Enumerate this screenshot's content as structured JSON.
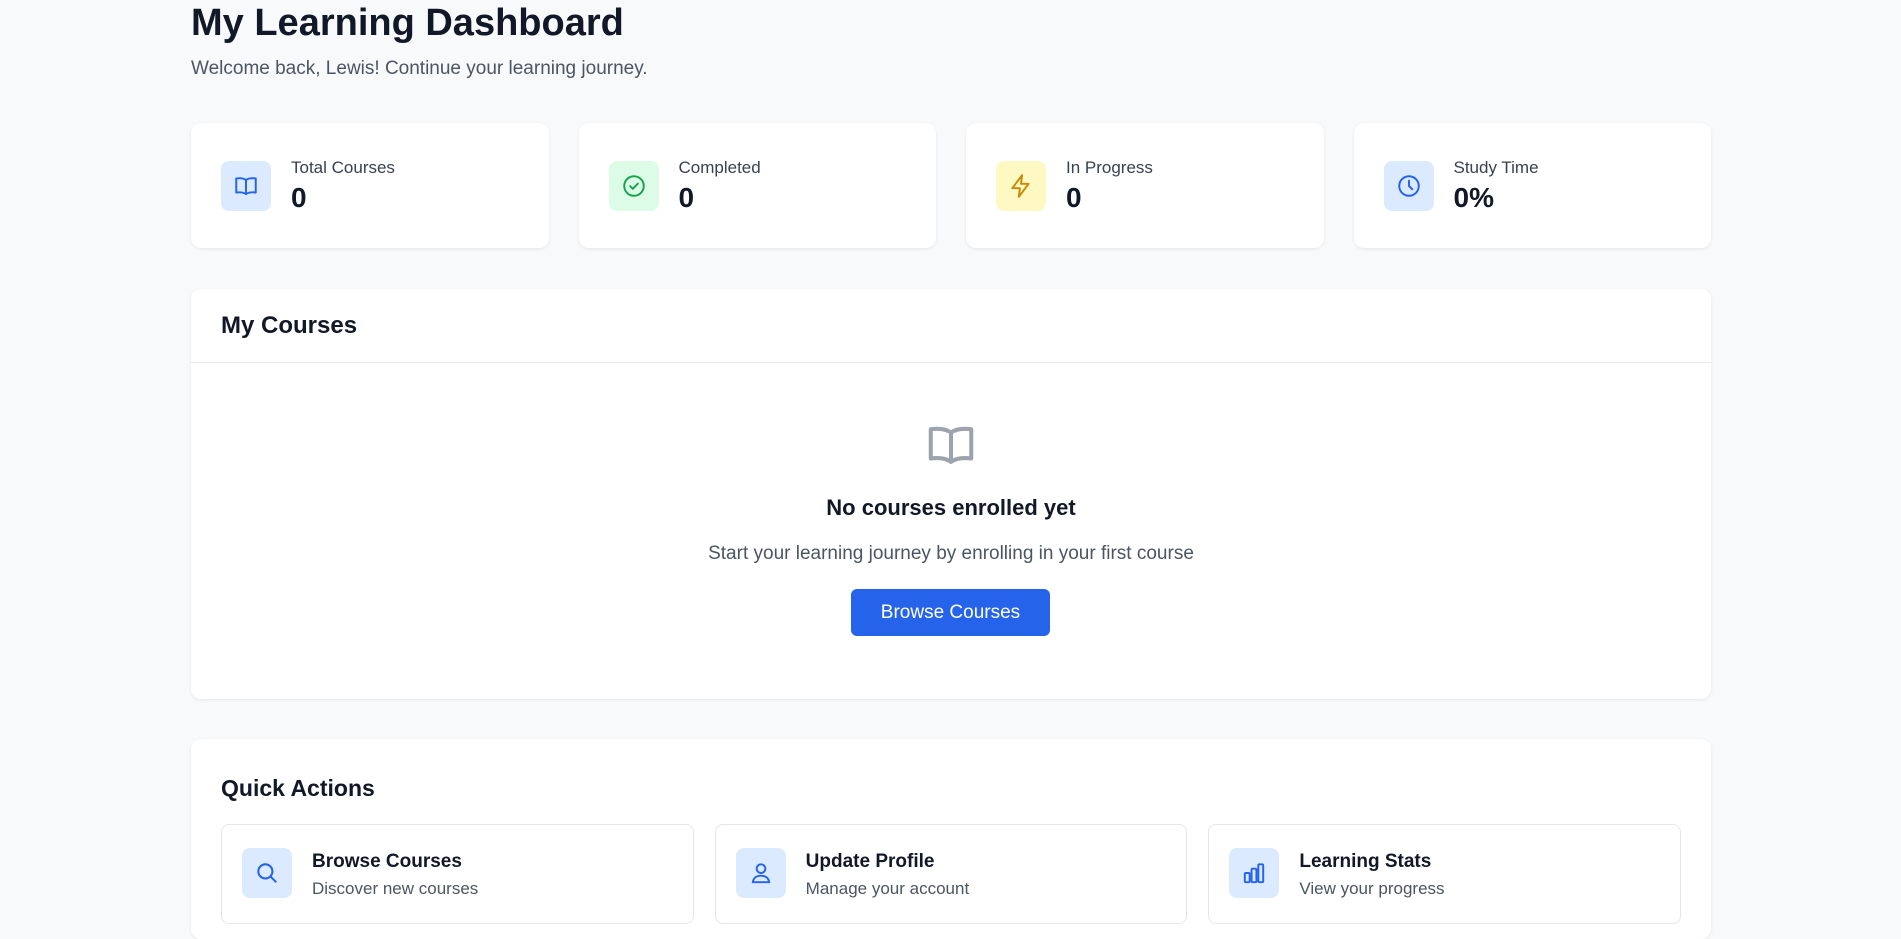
{
  "header": {
    "title": "My Learning Dashboard",
    "subtitle": "Welcome back, Lewis! Continue your learning journey."
  },
  "stats": [
    {
      "label": "Total Courses",
      "value": "0",
      "icon": "book-icon",
      "bg": "#dbeafe",
      "color": "#2563eb"
    },
    {
      "label": "Completed",
      "value": "0",
      "icon": "check-circle-icon",
      "bg": "#dcfce7",
      "color": "#16a34a"
    },
    {
      "label": "In Progress",
      "value": "0",
      "icon": "lightning-icon",
      "bg": "#fef9c3",
      "color": "#ca8a04"
    },
    {
      "label": "Study Time",
      "value": "0%",
      "icon": "clock-icon",
      "bg": "#dbeafe",
      "color": "#2563eb"
    }
  ],
  "courses": {
    "title": "My Courses",
    "empty_title": "No courses enrolled yet",
    "empty_desc": "Start your learning journey by enrolling in your first course",
    "button_label": "Browse Courses",
    "empty_icon": "book-icon"
  },
  "quick_actions": {
    "title": "Quick Actions",
    "items": [
      {
        "title": "Browse Courses",
        "desc": "Discover new courses",
        "icon": "search-icon"
      },
      {
        "title": "Update Profile",
        "desc": "Manage your account",
        "icon": "user-icon"
      },
      {
        "title": "Learning Stats",
        "desc": "View your progress",
        "icon": "bar-chart-icon"
      }
    ]
  },
  "colors": {
    "primary": "#2563eb",
    "background": "#f8f9fb",
    "text": "#111827",
    "muted": "#4b5563"
  }
}
